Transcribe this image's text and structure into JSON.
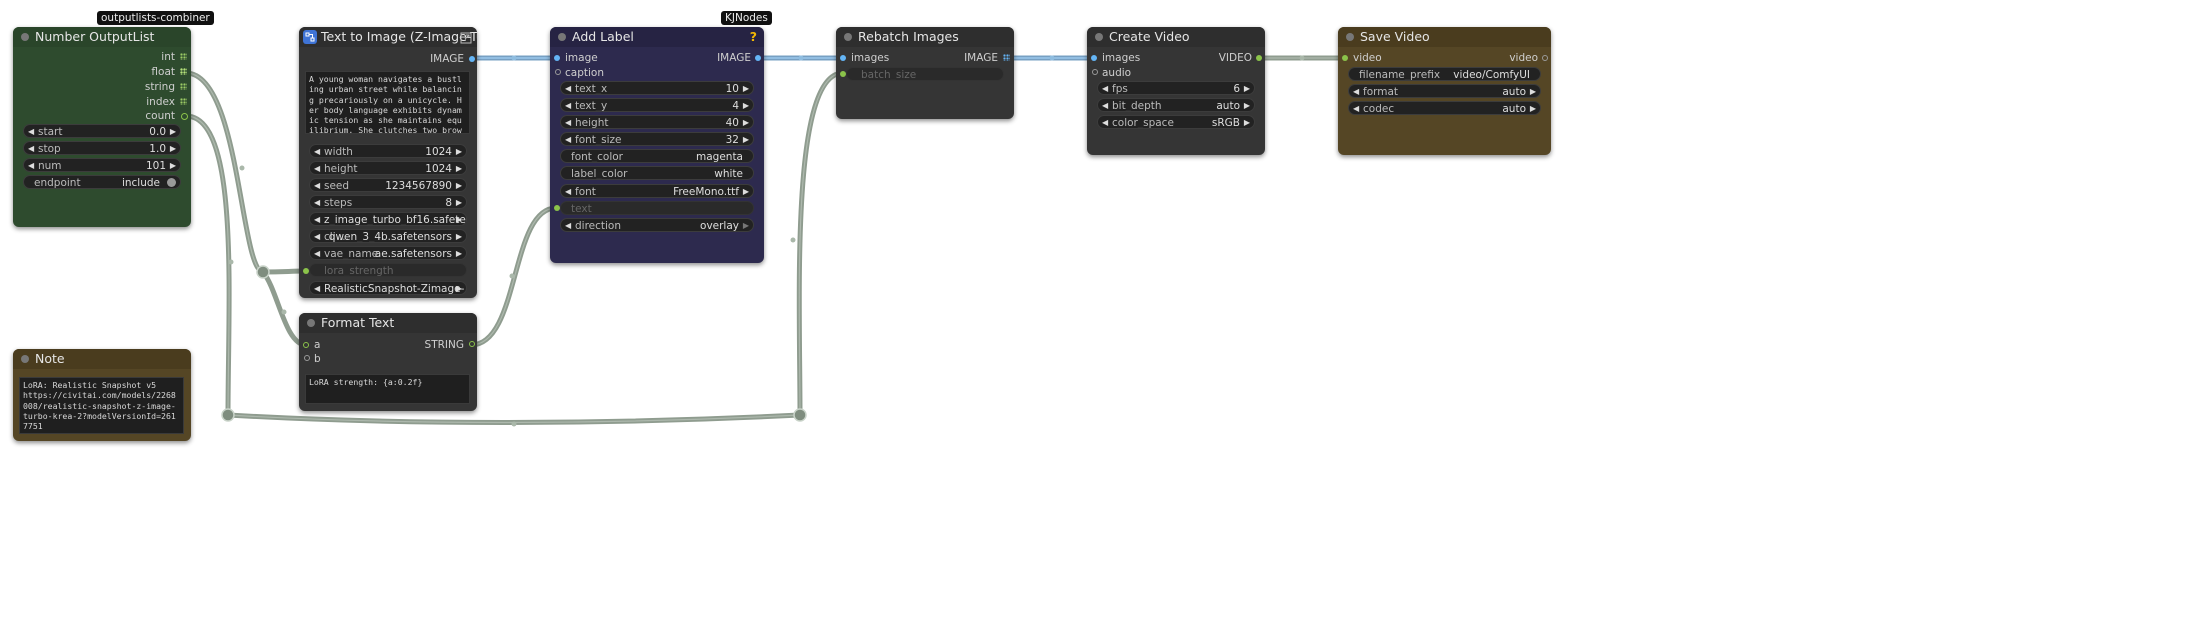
{
  "badges": {
    "combiner": "outputlists-combiner",
    "kjnodes": "KJNodes"
  },
  "colors": {
    "green_node": "#2e4b2e",
    "purple_node": "#2d2a4e",
    "brown_node": "#554625",
    "gray_node": "#353535",
    "wire": "#8f9c8f",
    "image_wire": "#64b5f6"
  },
  "number_outputlist": {
    "title": "Number OutputList",
    "outputs": [
      "int",
      "float",
      "string",
      "index",
      "count"
    ],
    "widgets": [
      {
        "label": "start",
        "value": "0.0"
      },
      {
        "label": "stop",
        "value": "1.0"
      },
      {
        "label": "num",
        "value": "101"
      }
    ],
    "toggle": {
      "label": "endpoint",
      "value": "include"
    }
  },
  "note": {
    "title": "Note",
    "text": "LoRA: Realistic Snapshot v5\nhttps://civitai.com/models/2268008/realistic-snapshot-z-image-turbo-krea-2?modelVersionId=2617751"
  },
  "text_to_image": {
    "title": "Text to Image (Z-Image-Tu...",
    "output": "IMAGE",
    "prompt": "A young woman navigates a bustling urban street while balancing precariously on a unicycle. Her body language exhibits dynamic tension as she maintains equilibrium. She clutches two brown paper grocery bags that overflow with produce. The bags'",
    "widgets": [
      {
        "label": "width",
        "value": "1024"
      },
      {
        "label": "height",
        "value": "1024"
      },
      {
        "label": "seed",
        "value": "1234567890"
      },
      {
        "label": "steps",
        "value": "8"
      },
      {
        "label": "",
        "value": "z_image_turbo_bf16.safete ..."
      },
      {
        "label": "cli ...",
        "value": "qwen_3_4b.safetensors"
      },
      {
        "label": "vae_name",
        "value": "ae.safetensors"
      }
    ],
    "lora_strength": "lora_strength",
    "lora_select": "RealisticSnapshot-Zimage- ..."
  },
  "format_text": {
    "title": "Format Text",
    "inputs": [
      "a",
      "b"
    ],
    "output": "STRING",
    "template": "LoRA strength: {a:0.2f}"
  },
  "add_label": {
    "title": "Add Label",
    "help": "?",
    "inputs": [
      "image",
      "caption"
    ],
    "output": "IMAGE",
    "widgets": [
      {
        "label": "text_x",
        "value": "10",
        "arrows": true
      },
      {
        "label": "text_y",
        "value": "4",
        "arrows": true
      },
      {
        "label": "height",
        "value": "40",
        "arrows": true
      },
      {
        "label": "font_size",
        "value": "32",
        "arrows": true
      },
      {
        "label": "font_color",
        "value": "magenta",
        "arrows": false
      },
      {
        "label": "label_color",
        "value": "white",
        "arrows": false
      },
      {
        "label": "font",
        "value": "FreeMono.ttf",
        "arrows": true
      }
    ],
    "text_placeholder": "text",
    "direction": {
      "label": "direction",
      "value": "overlay"
    }
  },
  "rebatch": {
    "title": "Rebatch Images",
    "input": "images",
    "output": "IMAGE",
    "batch_size": "batch_size"
  },
  "create_video": {
    "title": "Create Video",
    "inputs": [
      "images",
      "audio"
    ],
    "output": "VIDEO",
    "widgets": [
      {
        "label": "fps",
        "value": "6"
      },
      {
        "label": "bit_depth",
        "value": "auto"
      },
      {
        "label": "color_space",
        "value": "sRGB"
      }
    ]
  },
  "save_video": {
    "title": "Save Video",
    "input": "video",
    "output": "video",
    "filename_prefix": {
      "label": "filename_prefix",
      "value": "video/ComfyUI"
    },
    "widgets": [
      {
        "label": "format",
        "value": "auto"
      },
      {
        "label": "codec",
        "value": "auto"
      }
    ]
  }
}
